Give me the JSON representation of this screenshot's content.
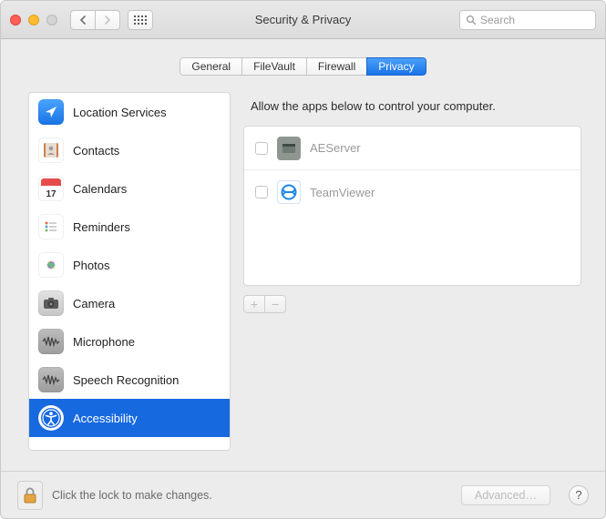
{
  "window": {
    "title": "Security & Privacy"
  },
  "search": {
    "placeholder": "Search"
  },
  "tabs": [
    {
      "label": "General",
      "selected": false
    },
    {
      "label": "FileVault",
      "selected": false
    },
    {
      "label": "Firewall",
      "selected": false
    },
    {
      "label": "Privacy",
      "selected": true
    }
  ],
  "sidebar": {
    "items": [
      {
        "label": "Location Services",
        "icon": "location-icon",
        "selected": false
      },
      {
        "label": "Contacts",
        "icon": "contacts-icon",
        "selected": false
      },
      {
        "label": "Calendars",
        "icon": "calendar-icon",
        "calendar_day": "17",
        "selected": false
      },
      {
        "label": "Reminders",
        "icon": "reminders-icon",
        "selected": false
      },
      {
        "label": "Photos",
        "icon": "photos-icon",
        "selected": false
      },
      {
        "label": "Camera",
        "icon": "camera-icon",
        "selected": false
      },
      {
        "label": "Microphone",
        "icon": "microphone-icon",
        "selected": false
      },
      {
        "label": "Speech Recognition",
        "icon": "speech-icon",
        "selected": false
      },
      {
        "label": "Accessibility",
        "icon": "accessibility-icon",
        "selected": true
      }
    ]
  },
  "main": {
    "description": "Allow the apps below to control your computer.",
    "apps": [
      {
        "name": "AEServer",
        "checked": false,
        "icon_color": "#8f9690"
      },
      {
        "name": "TeamViewer",
        "checked": false,
        "icon_color": "#32a0ee"
      }
    ]
  },
  "footer": {
    "lock_text": "Click the lock to make changes.",
    "advanced_label": "Advanced…",
    "help_label": "?"
  },
  "colors": {
    "accent": "#1769e0",
    "window_bg": "#ececec"
  }
}
